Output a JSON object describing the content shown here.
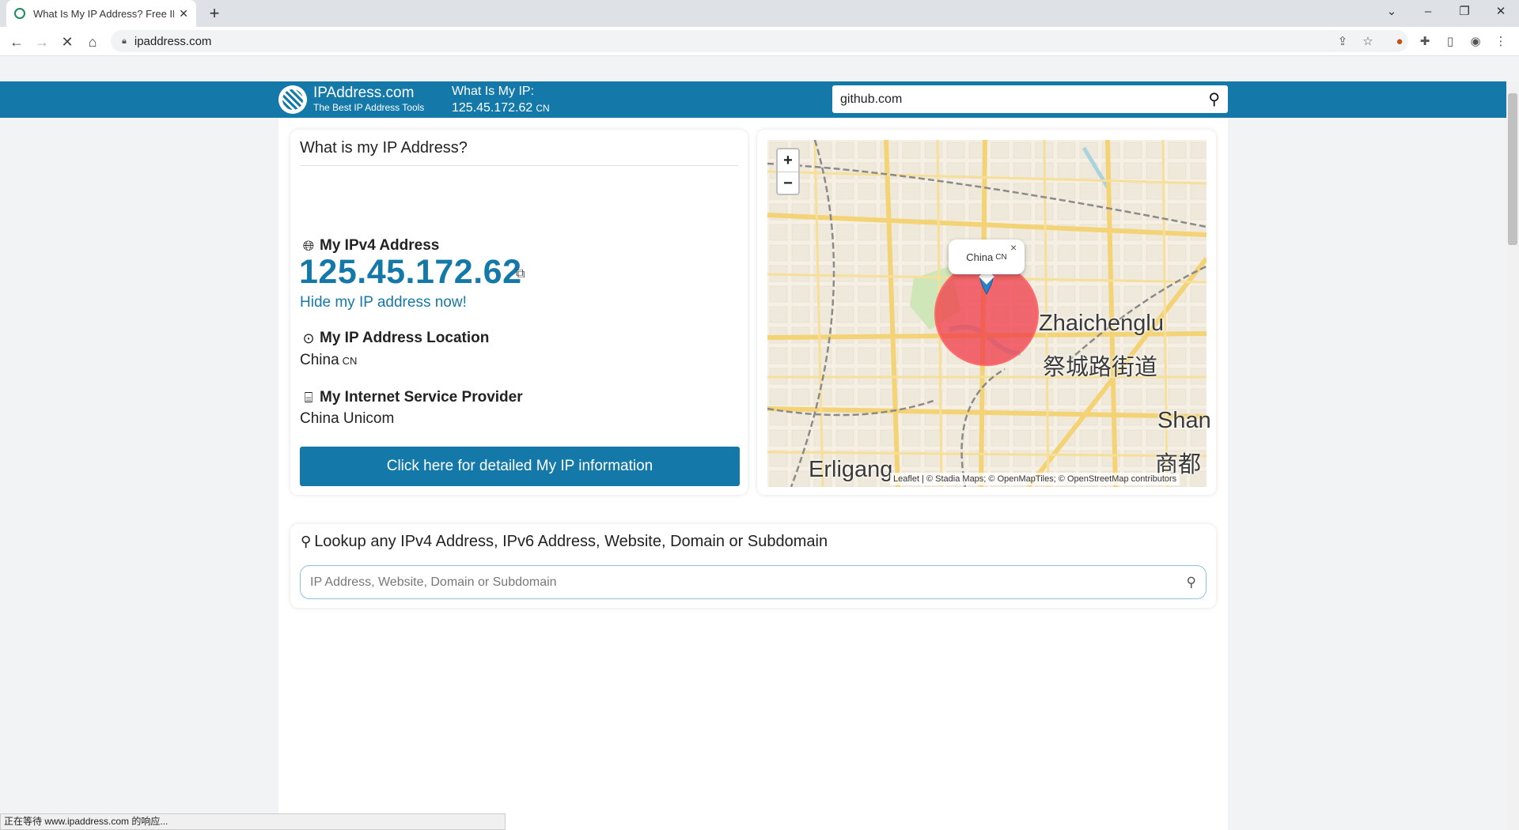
{
  "browser": {
    "tab_title": "What Is My IP Address? Free IP",
    "tab_close": "✕",
    "new_tab": "+",
    "url": "ipaddress.com",
    "window_controls": {
      "dropdown": "⌄",
      "minimize": "–",
      "restore": "❐",
      "close": "✕"
    }
  },
  "header": {
    "brand_name": "IPAddress.com",
    "brand_tagline": "The Best IP Address Tools",
    "myip_label": "What Is My IP:",
    "myip_value": "125.45.172.62",
    "myip_country_code": "CN",
    "search_value": "github.com"
  },
  "ip_card": {
    "title": "What is my IP Address?",
    "ipv4_label": "My IPv4 Address",
    "ipv4_value": "125.45.172.62",
    "hide_link": "Hide my IP address now!",
    "location_label": "My IP Address Location",
    "location_value": "China",
    "location_code": "CN",
    "isp_label": "My Internet Service Provider",
    "isp_value": "China Unicom",
    "detail_button": "Click here for detailed My IP information"
  },
  "map": {
    "zoom_in": "+",
    "zoom_out": "−",
    "popup_text": "China",
    "popup_code": "CN",
    "popup_close": "×",
    "labels": {
      "zhaichenglu_en": "Zhaichenglu",
      "zhaichenglu_zh": "祭城路街道",
      "erligang": "Erligang",
      "shan": "Shan",
      "shangdu": "商都"
    },
    "attribution": "Leaflet | © Stadia Maps; © OpenMapTiles; © OpenStreetMap contributors"
  },
  "lookup": {
    "title": "Lookup any IPv4 Address, IPv6 Address, Website, Domain or Subdomain",
    "placeholder": "IP Address, Website, Domain or Subdomain"
  },
  "status_bar": "正在等待 www.ipaddress.com 的响应..."
}
